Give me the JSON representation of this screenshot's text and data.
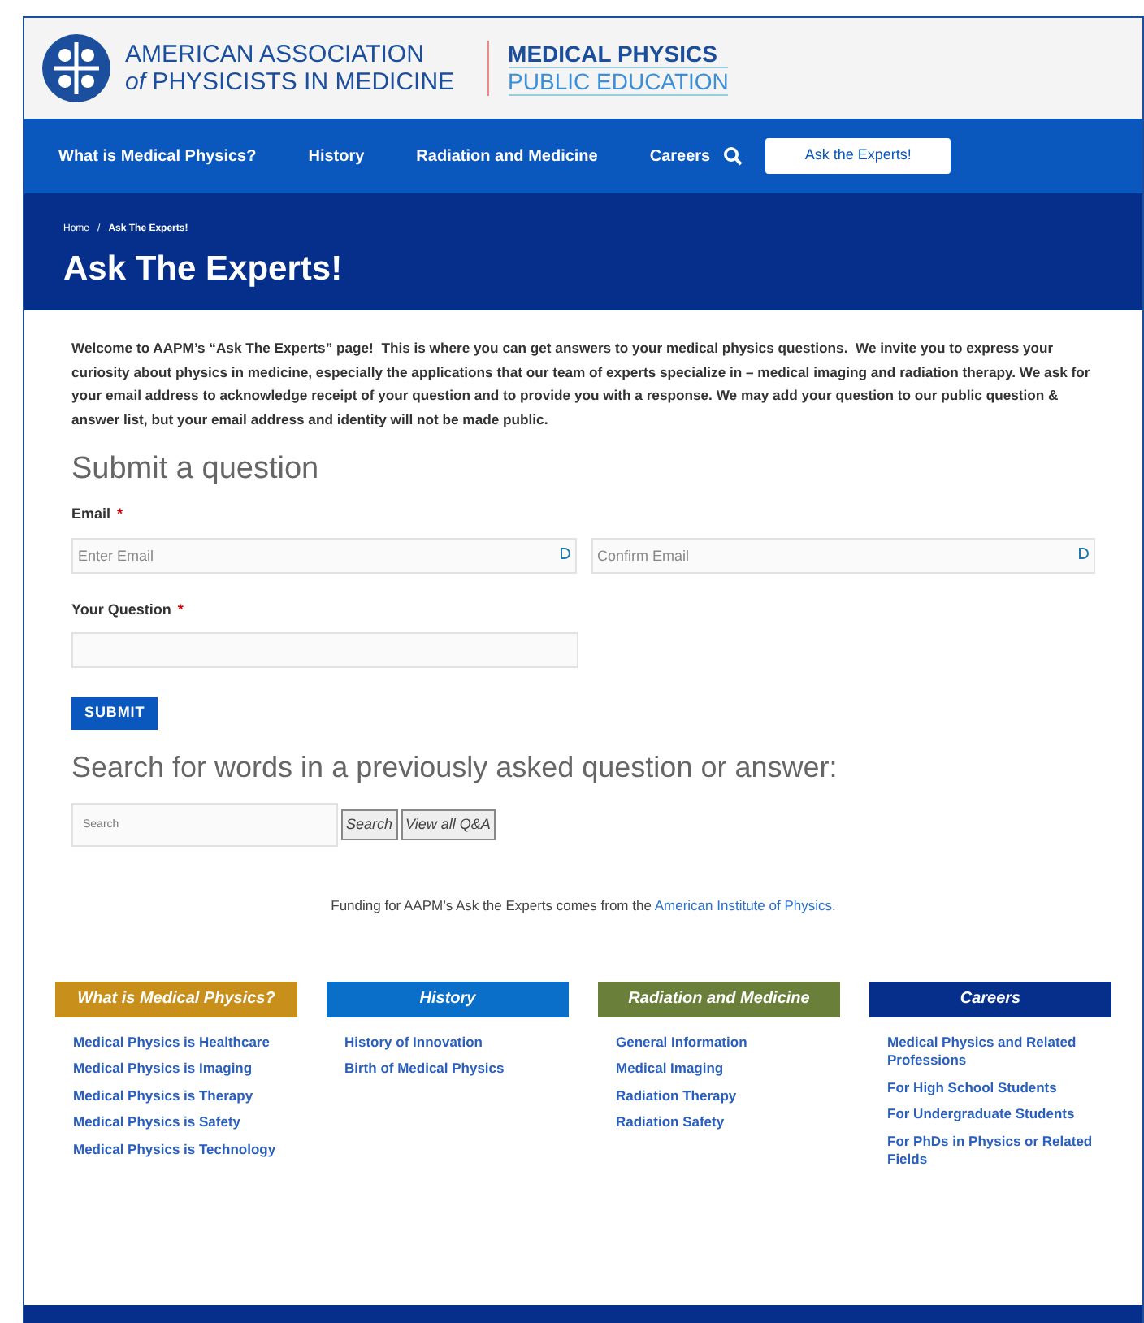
{
  "header": {
    "org_line_1": "AMERICAN ASSOCIATION",
    "org_line_2": "*of* PHYSICISTS IN MEDICINE",
    "site_line_1": "MEDICAL PHYSICS",
    "site_line_2": "PUBLIC EDUCATION"
  },
  "nav": {
    "items": [
      {
        "label": "What is Medical Physics?"
      },
      {
        "label": "History"
      },
      {
        "label": "Radiation and Medicine"
      },
      {
        "label": "Careers"
      }
    ],
    "button": "Ask the Experts!"
  },
  "breadcrumb": [
    "Home",
    "/",
    "Ask The Experts!"
  ],
  "page_title": "Ask The Experts!",
  "intro": "Welcome to AAPM’s “Ask The Experts” page!  This is where you can get answers to your medical physics questions.  We invite you to express your curiosity about physics in medicine, especially the applications that our team of experts specialize in – medical imaging and radiation therapy. We ask for your email address to acknowledge receipt of your question and to provide you with a response. We may add your question to our public question & answer list, but your email address and identity will not be made public.",
  "form": {
    "heading": "Submit a question",
    "email_label": "Email",
    "required_mark": "*",
    "email_placeholder": "Enter Email",
    "confirm_placeholder": "Confirm Email",
    "question_label": "Your Question",
    "submit": "SUBMIT"
  },
  "search": {
    "heading": "Search for words in a previously asked question or answer:",
    "placeholder": "Search",
    "search_button": "Search",
    "view_all_button": "View all Q&A"
  },
  "funding": {
    "text": "Funding for AAPM’s Ask the Experts comes from the",
    "link": "American Institute of Physics",
    "end": "."
  },
  "footer_columns": [
    {
      "title": "What is Medical Physics?",
      "color": "#c8901a",
      "links": [
        "Medical Physics is Healthcare",
        "Medical Physics is Imaging",
        "Medical Physics is Therapy",
        "Medical Physics is Safety",
        "Medical Physics is Technology"
      ]
    },
    {
      "title": "History",
      "color": "#0a6fc9",
      "links": [
        "History of Innovation",
        "Birth of Medical Physics"
      ]
    },
    {
      "title": "Radiation and Medicine",
      "color": "#6a7f3a",
      "links": [
        "General Information",
        "Medical Imaging",
        "Radiation Therapy",
        "Radiation Safety"
      ]
    },
    {
      "title": "Careers",
      "color": "#062f8c",
      "links": [
        "Medical Physics and Related Professions",
        "For High School Students",
        "For Undergraduate Students",
        "For PhDs in Physics or Related Fields"
      ]
    }
  ]
}
